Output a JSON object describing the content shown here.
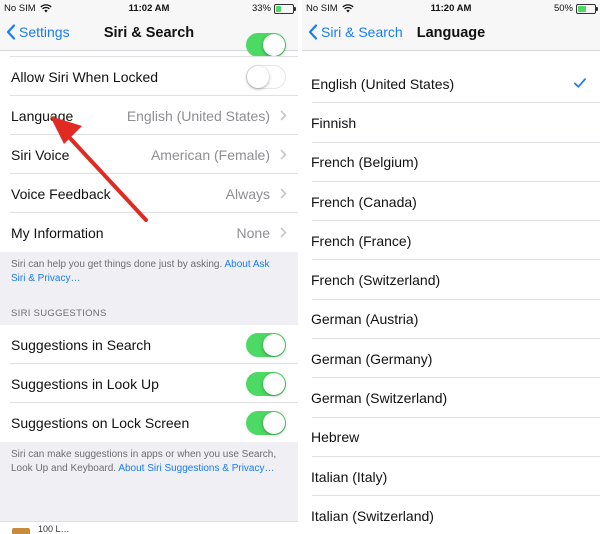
{
  "left": {
    "status": {
      "carrier": "No SIM",
      "time": "11:02 AM",
      "battery": "33%"
    },
    "nav": {
      "back": "Settings",
      "title": "Siri & Search"
    },
    "rows": [
      {
        "label": "Allow Siri When Locked",
        "toggle": "off"
      },
      {
        "label": "Language",
        "value": "English (United States)"
      },
      {
        "label": "Siri Voice",
        "value": "American (Female)"
      },
      {
        "label": "Voice Feedback",
        "value": "Always"
      },
      {
        "label": "My Information",
        "value": "None"
      }
    ],
    "note1": {
      "text": "Siri can help you get things done just by asking. ",
      "link": "About Ask Siri & Privacy…"
    },
    "suggestions_header": "SIRI SUGGESTIONS",
    "suggestions": [
      {
        "label": "Suggestions in Search",
        "toggle": "on"
      },
      {
        "label": "Suggestions in Look Up",
        "toggle": "on"
      },
      {
        "label": "Suggestions on Lock Screen",
        "toggle": "on"
      }
    ],
    "note2": {
      "text": "Siri can make suggestions in apps or when you use Search, Look Up and Keyboard. ",
      "link": "About Siri Suggestions & Privacy…"
    },
    "bottom_cut_text": "100 L…"
  },
  "right": {
    "status": {
      "carrier": "No SIM",
      "time": "11:20 AM",
      "battery": "50%"
    },
    "nav": {
      "back": "Siri & Search",
      "title": "Language"
    },
    "languages": [
      "English (United States)",
      "Finnish",
      "French (Belgium)",
      "French (Canada)",
      "French (France)",
      "French (Switzerland)",
      "German (Austria)",
      "German (Germany)",
      "German (Switzerland)",
      "Hebrew",
      "Italian (Italy)",
      "Italian (Switzerland)"
    ],
    "selected_index": 0
  },
  "colors": {
    "accent": "#1a7cf5",
    "toggle_on": "#4cd964",
    "arrow": "#e02a22"
  }
}
